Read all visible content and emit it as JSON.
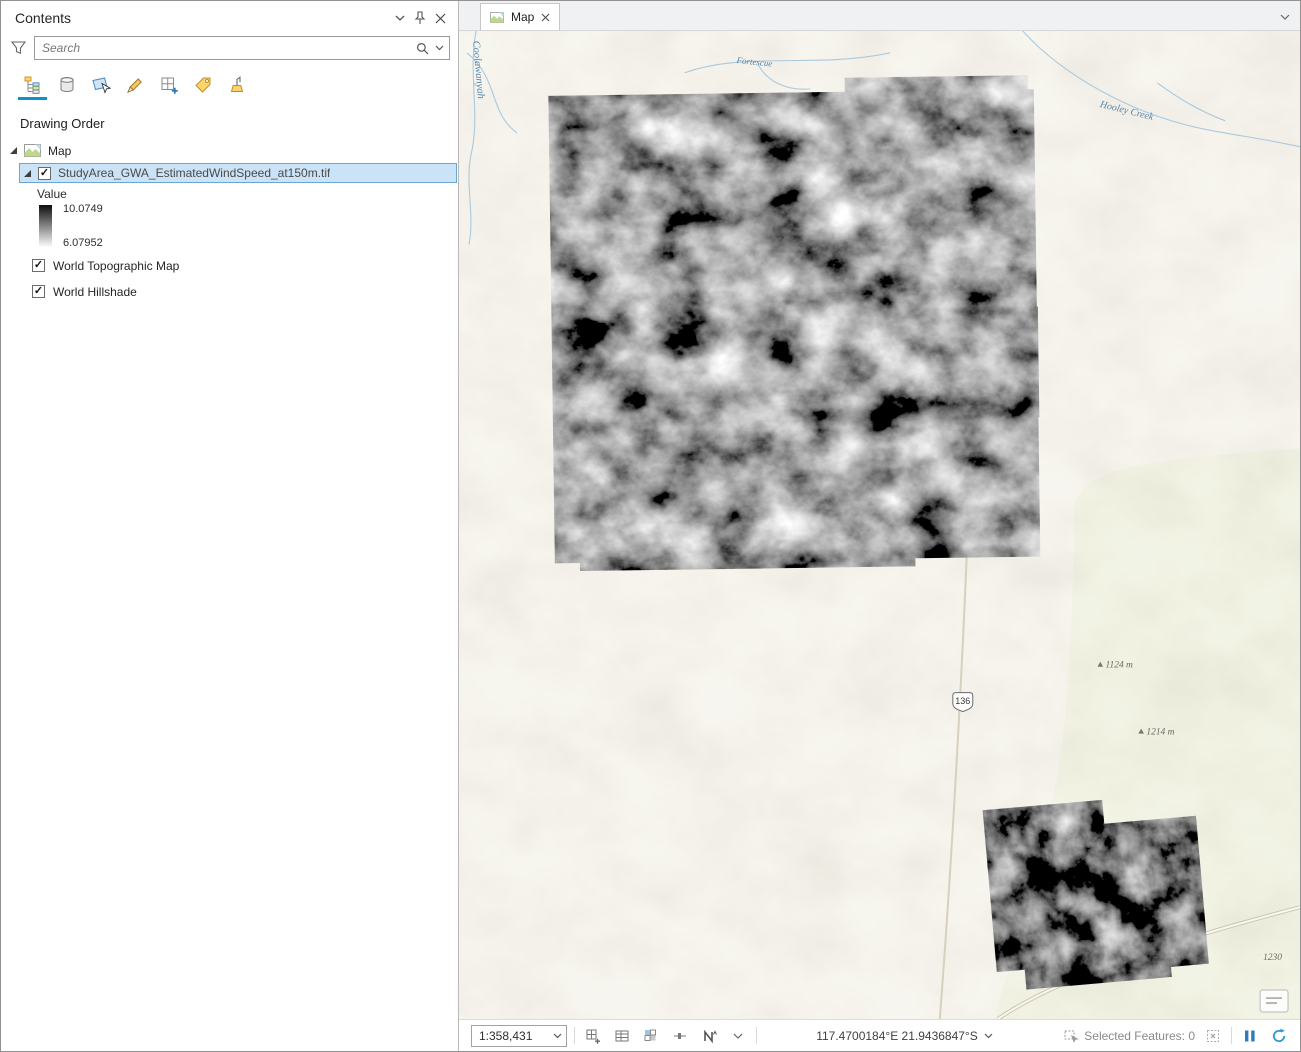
{
  "colors": {
    "accent_blue": "#0b92d0",
    "selection_fill": "#cbe3f6",
    "selection_border": "#6ea6cf",
    "pause_blue": "#2e7cb8",
    "sync_blue": "#2f9ad0",
    "ramp_top": "#0d0d0d",
    "ramp_bottom": "#fdfdfd",
    "basemap_ground": "#f1efe6",
    "basemap_green": "#e9ecd6"
  },
  "icons": {
    "search": "magnifier",
    "filter": "funnel",
    "pin": "pushpin",
    "close": "x-cross",
    "chevron": "chevron-down",
    "pause": "double-bar",
    "sync": "circular-arrows"
  },
  "contents": {
    "title": "Contents",
    "search_placeholder": "Search",
    "section_label": "Drawing Order",
    "tree": {
      "map_label": "Map",
      "layer_tif": "StudyArea_GWA_EstimatedWindSpeed_at150m.tif",
      "legend_title": "Value",
      "legend_max": "10.0749",
      "legend_min": "6.07952",
      "layer_topo": "World Topographic Map",
      "layer_hillshade": "World Hillshade"
    }
  },
  "map_view": {
    "tab_label": "Map",
    "labels": {
      "creek1": "Hooley Creek",
      "creek2": "Fortescue",
      "place": "Coolawanyah",
      "route": "136",
      "elev1": "1124 m",
      "elev2": "1214 m",
      "elev3": "1230"
    }
  },
  "status_bar": {
    "scale": "1:358,431",
    "coordinates": "117.4700184°E 21.9436847°S",
    "selected_features": "Selected Features: 0"
  }
}
